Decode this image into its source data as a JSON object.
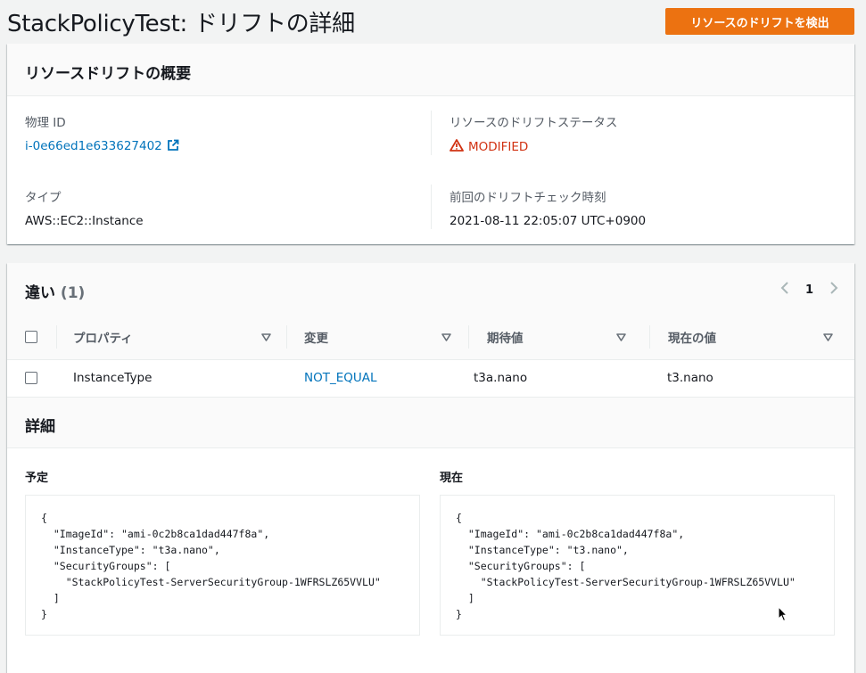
{
  "header": {
    "title": "StackPolicyTest: ドリフトの詳細",
    "detect_button": "リソースのドリフトを検出"
  },
  "overview": {
    "title": "リソースドリフトの概要",
    "physical_id_label": "物理 ID",
    "physical_id_value": "i-0e66ed1e633627402",
    "drift_status_label": "リソースのドリフトステータス",
    "drift_status_value": "MODIFIED",
    "type_label": "タイプ",
    "type_value": "AWS::EC2::Instance",
    "last_check_label": "前回のドリフトチェック時刻",
    "last_check_value": "2021-08-11 22:05:07 UTC+0900"
  },
  "differences": {
    "title": "違い",
    "count": "(1)",
    "page": "1",
    "columns": [
      "プロパティ",
      "変更",
      "期待値",
      "現在の値"
    ],
    "rows": [
      {
        "property": "InstanceType",
        "change": "NOT_EQUAL",
        "expected": "t3a.nano",
        "current": "t3.nano"
      }
    ]
  },
  "details": {
    "title": "詳細",
    "expected_label": "予定",
    "current_label": "現在",
    "expected_json": "{\n  \"ImageId\": \"ami-0c2b8ca1dad447f8a\",\n  \"InstanceType\": \"t3a.nano\",\n  \"SecurityGroups\": [\n    \"StackPolicyTest-ServerSecurityGroup-1WFRSLZ65VVLU\"\n  ]\n}",
    "current_json": "{\n  \"ImageId\": \"ami-0c2b8ca1dad447f8a\",\n  \"InstanceType\": \"t3.nano\",\n  \"SecurityGroups\": [\n    \"StackPolicyTest-ServerSecurityGroup-1WFRSLZ65VVLU\"\n  ]\n}"
  },
  "colors": {
    "accent_orange": "#ec7211",
    "link_blue": "#0073bb",
    "status_red": "#d13212"
  },
  "icons": [
    "external-link-icon",
    "warning-icon",
    "chevron-left-icon",
    "chevron-right-icon",
    "sort-caret-icon",
    "mouse-cursor-icon"
  ]
}
